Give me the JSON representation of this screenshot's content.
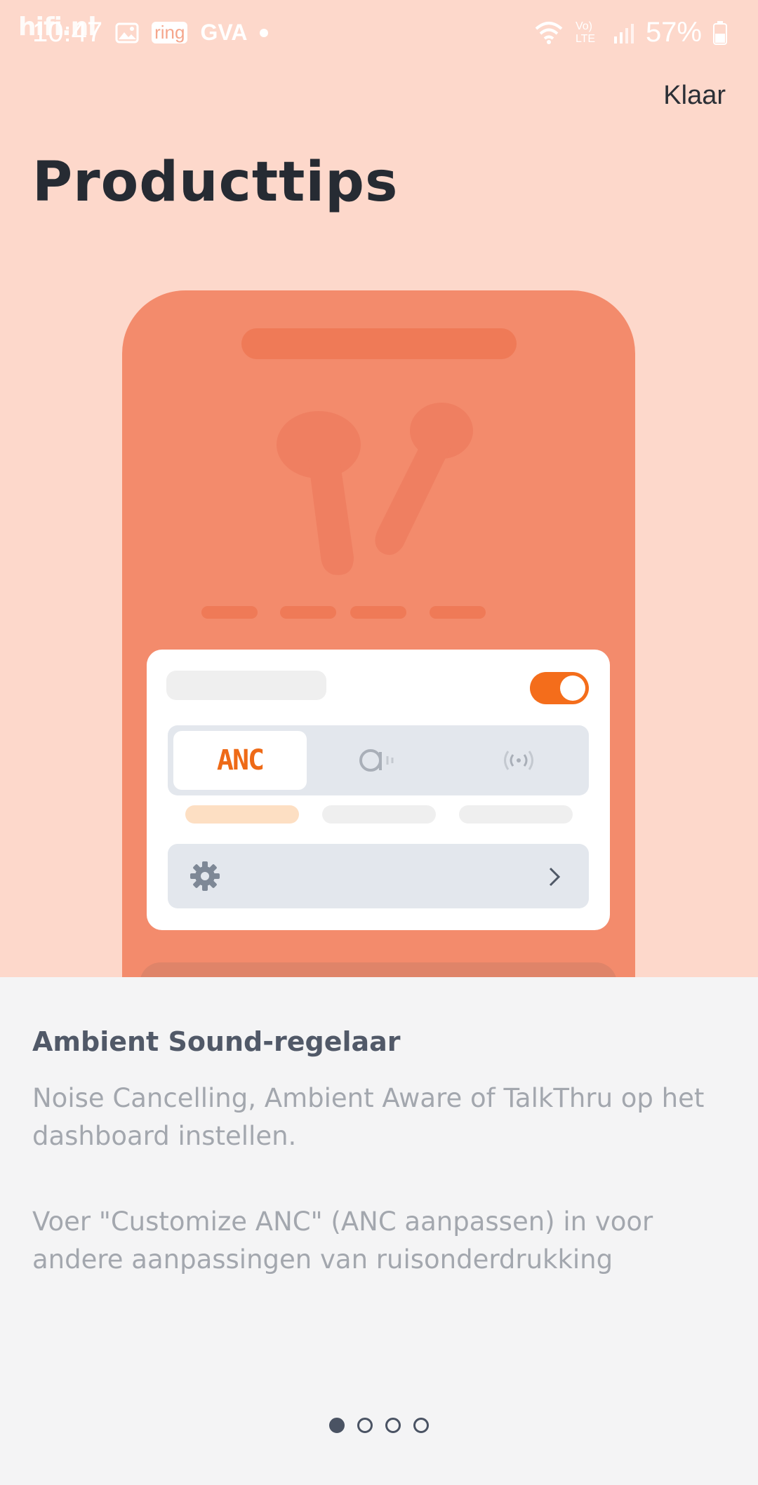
{
  "status_bar": {
    "time": "10:47",
    "notification_labels": [
      "ring",
      "GVA"
    ],
    "battery": "57%",
    "network": "Vo) LTE"
  },
  "watermark": "hifi.nl",
  "header": {
    "done_label": "Klaar",
    "title": "Producttips"
  },
  "illustration": {
    "mode_active": "ANC"
  },
  "tip": {
    "title": "Ambient Sound-regelaar",
    "paragraph1": "Noise Cancelling, Ambient Aware of TalkThru op het dashboard instellen.",
    "paragraph2": "Voer \"Customize ANC\" (ANC aanpassen) in voor andere aanpassingen van ruisonderdrukking"
  },
  "pager": {
    "total": 4,
    "active_index": 0
  },
  "colors": {
    "background": "#fdd8cb",
    "phone": "#f38b6c",
    "accent": "#f46d1b",
    "title_text": "#262b33"
  }
}
